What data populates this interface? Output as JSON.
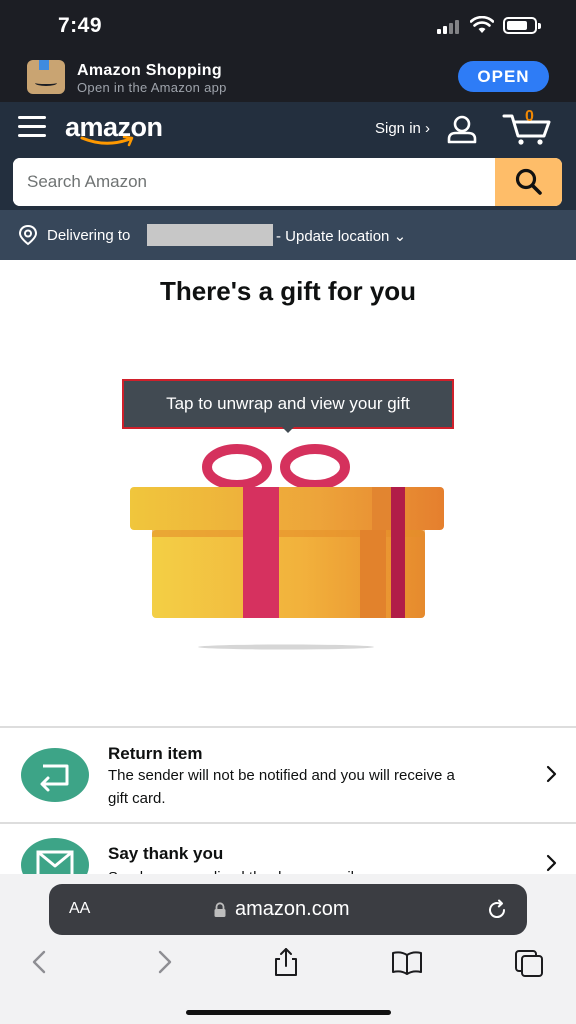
{
  "status_bar": {
    "time": "7:49"
  },
  "app_banner": {
    "name": "Amazon Shopping",
    "subtitle": "Open in the Amazon app",
    "open_label": "OPEN",
    "accent": "#2e7cf6"
  },
  "header": {
    "logo": "amazon",
    "signin_label": "Sign in ›",
    "cart_count": "0",
    "nav_bg": "#232f3e",
    "accent": "#febd69"
  },
  "search": {
    "placeholder": "Search Amazon",
    "value": ""
  },
  "delivery": {
    "prefix": "Delivering to",
    "update_label": "- Update location ⌄"
  },
  "gift": {
    "title": "There's a gift for you",
    "tooltip": "Tap to unwrap and view your gift"
  },
  "actions": [
    {
      "title": "Return item",
      "description": "The sender will not be notified and you will receive a gift card.",
      "icon": "return-icon"
    },
    {
      "title": "Say thank you",
      "description": "Send a personalized thank you email",
      "icon": "envelope-icon"
    }
  ],
  "browser": {
    "aa_label": "AA",
    "url": "amazon.com",
    "toolbar_icons": [
      "back-icon",
      "forward-icon",
      "share-icon",
      "bookmarks-icon",
      "tabs-icon"
    ]
  }
}
